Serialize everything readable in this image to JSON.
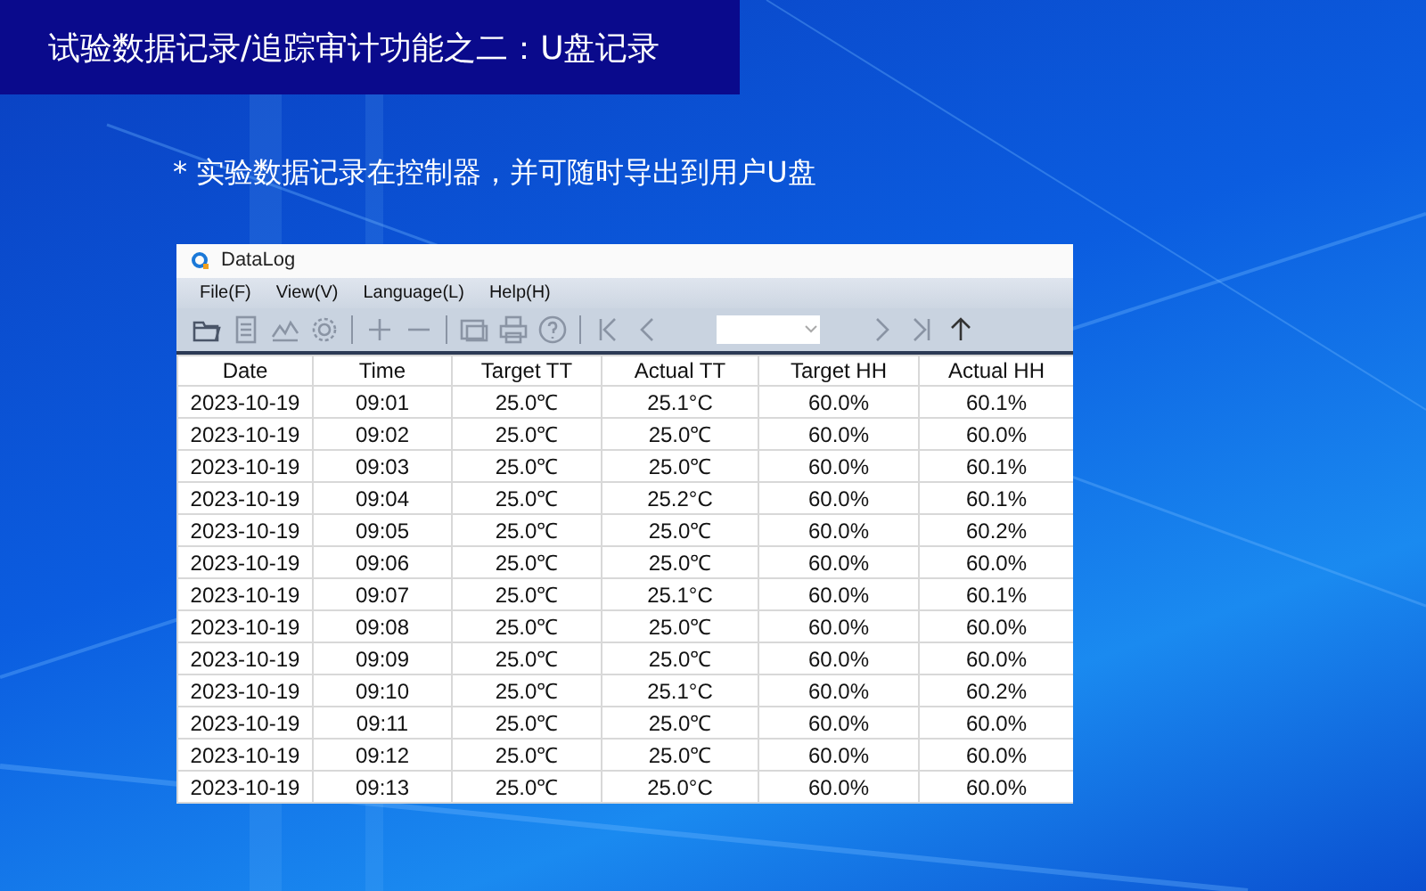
{
  "slide": {
    "title": "试验数据记录/追踪审计功能之二：U盘记录",
    "note": "* 实验数据记录在控制器，并可随时导出到用户U盘"
  },
  "window": {
    "title": "DataLog"
  },
  "menu": [
    "File(F)",
    "View(V)",
    "Language(L)",
    "Help(H)"
  ],
  "table": {
    "columns": [
      "Date",
      "Time",
      "Target TT",
      "Actual TT",
      "Target HH",
      "Actual HH"
    ],
    "rows": [
      [
        "2023-10-19",
        "09:01",
        "25.0℃",
        "25.1°C",
        "60.0%",
        "60.1%"
      ],
      [
        "2023-10-19",
        "09:02",
        "25.0℃",
        "25.0℃",
        "60.0%",
        "60.0%"
      ],
      [
        "2023-10-19",
        "09:03",
        "25.0℃",
        "25.0℃",
        "60.0%",
        "60.1%"
      ],
      [
        "2023-10-19",
        "09:04",
        "25.0℃",
        "25.2°C",
        "60.0%",
        "60.1%"
      ],
      [
        "2023-10-19",
        "09:05",
        "25.0℃",
        "25.0℃",
        "60.0%",
        "60.2%"
      ],
      [
        "2023-10-19",
        "09:06",
        "25.0℃",
        "25.0℃",
        "60.0%",
        "60.0%"
      ],
      [
        "2023-10-19",
        "09:07",
        "25.0℃",
        "25.1°C",
        "60.0%",
        "60.1%"
      ],
      [
        "2023-10-19",
        "09:08",
        "25.0℃",
        "25.0℃",
        "60.0%",
        "60.0%"
      ],
      [
        "2023-10-19",
        "09:09",
        "25.0℃",
        "25.0℃",
        "60.0%",
        "60.0%"
      ],
      [
        "2023-10-19",
        "09:10",
        "25.0℃",
        "25.1°C",
        "60.0%",
        "60.2%"
      ],
      [
        "2023-10-19",
        "09:11",
        "25.0℃",
        "25.0℃",
        "60.0%",
        "60.0%"
      ],
      [
        "2023-10-19",
        "09:12",
        "25.0℃",
        "25.0℃",
        "60.0%",
        "60.0%"
      ],
      [
        "2023-10-19",
        "09:13",
        "25.0℃",
        "25.0°C",
        "60.0%",
        "60.0%"
      ]
    ]
  }
}
